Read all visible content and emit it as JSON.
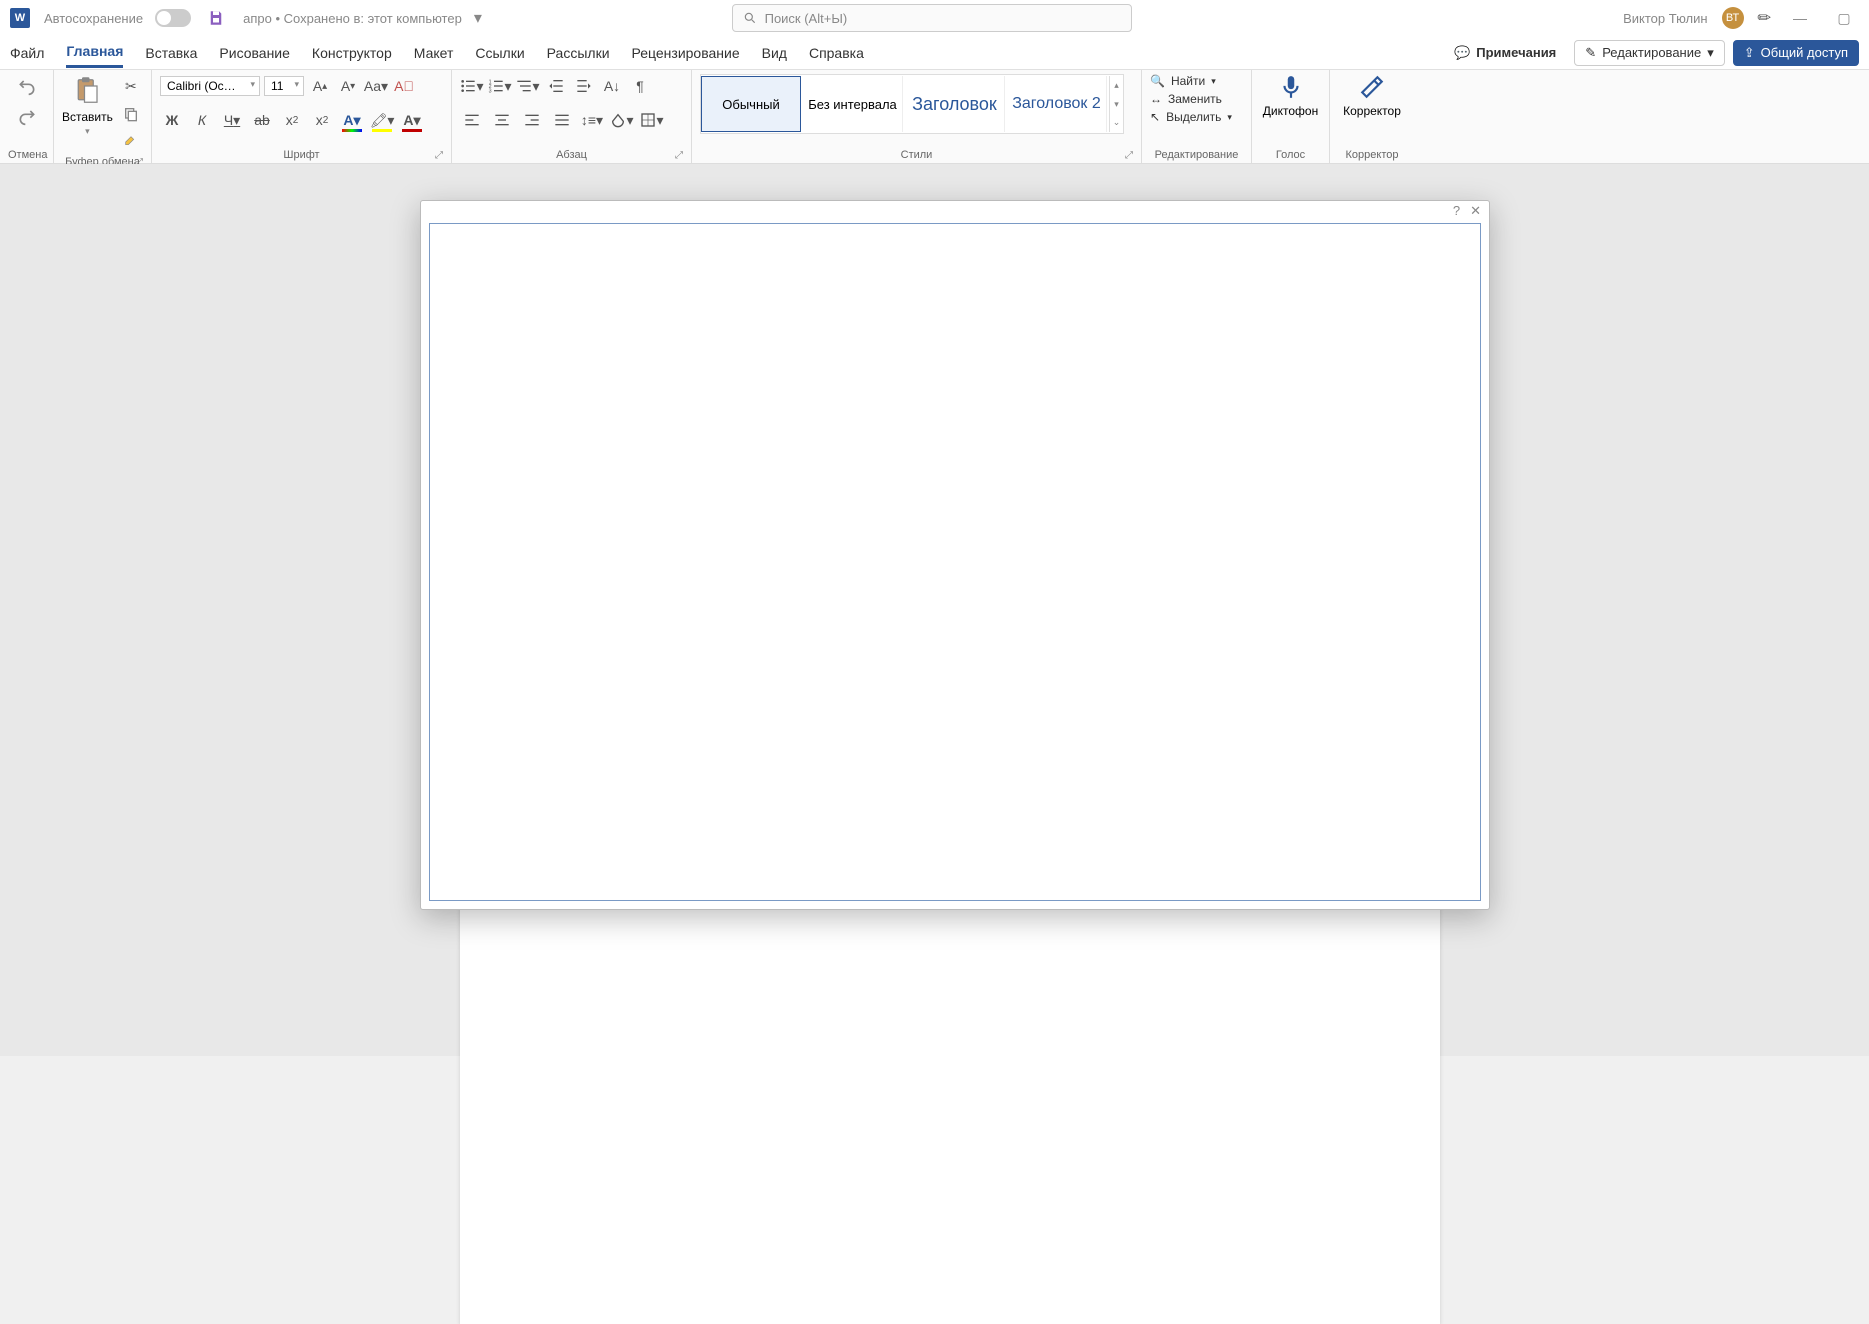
{
  "titlebar": {
    "autosave": "Автосохранение",
    "doc": "апро • Сохранено в: этот компьютер",
    "search_placeholder": "Поиск (Alt+Ы)",
    "user": "Виктор Тюлин",
    "initials": "ВТ"
  },
  "tabs": {
    "file": "Файл",
    "home": "Главная",
    "insert": "Вставка",
    "draw": "Рисование",
    "design": "Конструктор",
    "layout": "Макет",
    "references": "Ссылки",
    "mailings": "Рассылки",
    "review": "Рецензирование",
    "view": "Вид",
    "help": "Справка",
    "comments": "Примечания",
    "editing": "Редактирование",
    "share": "Общий доступ"
  },
  "ribbon": {
    "undo_group": "Отмена",
    "clipboard": {
      "paste": "Вставить",
      "group": "Буфер обмена"
    },
    "font": {
      "name": "Calibri (Основной",
      "size": "11",
      "group": "Шрифт",
      "bold": "Ж",
      "italic": "К",
      "underline": "Ч",
      "text_case": "Aa"
    },
    "paragraph": {
      "group": "Абзац"
    },
    "styles": {
      "normal": "Обычный",
      "no_spacing": "Без интервала",
      "heading1": "Заголовок",
      "heading2": "Заголовок 2",
      "group": "Стили"
    },
    "editing": {
      "find": "Найти",
      "replace": "Заменить",
      "select": "Выделить",
      "group": "Редактирование"
    },
    "voice": {
      "dictate": "Диктофон",
      "group": "Голос"
    },
    "editor": {
      "label": "Корректор",
      "group": "Корректор"
    }
  },
  "dialog": {
    "help": "?",
    "close": "✕"
  }
}
